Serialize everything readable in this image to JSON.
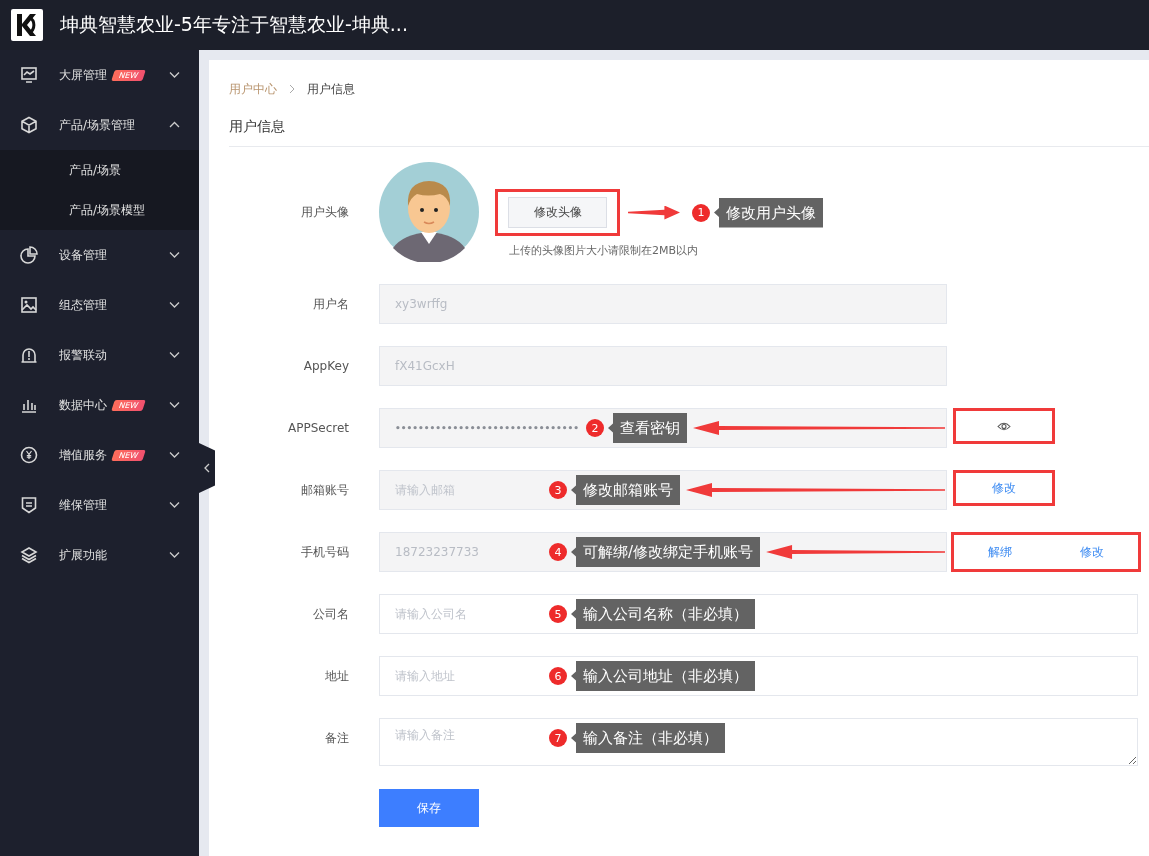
{
  "app": {
    "title": "坤典智慧农业-5年专注于智慧农业-坤典..."
  },
  "sidebar": {
    "items": [
      {
        "label": "大屏管理",
        "badge": "NEW",
        "expanded": false
      },
      {
        "label": "产品/场景管理",
        "expanded": true,
        "children": [
          {
            "label": "产品/场景"
          },
          {
            "label": "产品/场景模型"
          }
        ]
      },
      {
        "label": "设备管理",
        "expanded": false
      },
      {
        "label": "组态管理",
        "expanded": false
      },
      {
        "label": "报警联动",
        "expanded": false
      },
      {
        "label": "数据中心",
        "badge": "NEW",
        "expanded": false
      },
      {
        "label": "增值服务",
        "badge": "NEW",
        "expanded": false
      },
      {
        "label": "维保管理",
        "expanded": false
      },
      {
        "label": "扩展功能",
        "expanded": false
      }
    ]
  },
  "breadcrumb": [
    "用户中心",
    "用户信息"
  ],
  "heading": "用户信息",
  "form": {
    "rows": [
      {
        "kind": "avatar",
        "label": "用户头像",
        "button": "修改头像",
        "hint": "上传的头像图片大小请限制在2MB以内",
        "highlighted": true,
        "note": {
          "number": "1",
          "text": "修改用户头像"
        }
      },
      {
        "kind": "input",
        "label": "用户名",
        "value": "xy3wrffg",
        "disabled": true
      },
      {
        "kind": "input",
        "label": "AppKey",
        "value": "fX41GcxH",
        "disabled": true
      },
      {
        "kind": "secret",
        "label": "APPSecret",
        "value": "••••••••••••••••••••••••••••••••",
        "disabled": true,
        "highlighted": true,
        "actions": [
          {
            "kind": "icon"
          }
        ],
        "note": {
          "number": "2",
          "text": "查看密钥"
        }
      },
      {
        "kind": "input",
        "label": "邮箱账号",
        "placeholder": "请输入邮箱",
        "disabled": true,
        "highlighted": true,
        "actions": [
          {
            "kind": "link",
            "label": "修改"
          }
        ],
        "note": {
          "number": "3",
          "text": "修改邮箱账号"
        }
      },
      {
        "kind": "input",
        "label": "手机号码",
        "value": "18723237733",
        "disabled": true,
        "highlighted": true,
        "actions": [
          {
            "kind": "link",
            "label": "解绑"
          },
          {
            "kind": "link",
            "label": "修改"
          }
        ],
        "note": {
          "number": "4",
          "text": "可解绑/修改绑定手机账号"
        }
      },
      {
        "kind": "input",
        "label": "公司名",
        "placeholder": "请输入公司名",
        "disabled": false,
        "note": {
          "number": "5",
          "text": "输入公司名称（非必填）"
        }
      },
      {
        "kind": "input",
        "label": "地址",
        "placeholder": "请输入地址",
        "disabled": false,
        "note": {
          "number": "6",
          "text": "输入公司地址（非必填）"
        }
      },
      {
        "kind": "textarea",
        "label": "备注",
        "placeholder": "请输入备注",
        "disabled": false,
        "note": {
          "number": "7",
          "text": "输入备注（非必填）"
        }
      }
    ],
    "submit": "保存"
  }
}
